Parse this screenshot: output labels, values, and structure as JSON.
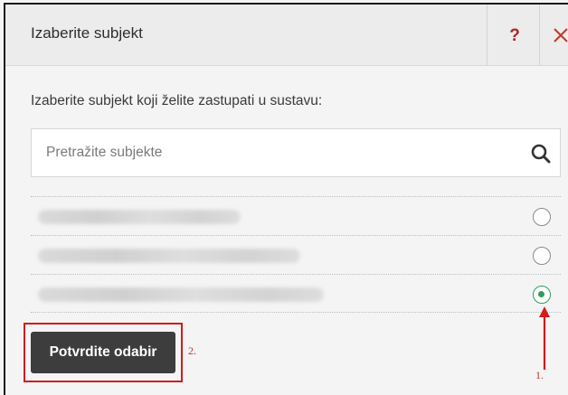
{
  "dialog": {
    "title": "Izaberite subjekt",
    "help_label": "?",
    "instruction": "Izaberite subjekt koji želite zastupati u sustavu:",
    "search": {
      "placeholder": "Pretražite subjekte",
      "value": ""
    },
    "subjects": [
      {
        "name_blurred": true,
        "selected": false
      },
      {
        "name_blurred": true,
        "selected": false
      },
      {
        "name_blurred": true,
        "selected": true
      }
    ],
    "confirm_label": "Potvrdite odabir"
  },
  "annotations": {
    "step1": "1.",
    "step2": "2."
  },
  "icons": {
    "help": "question-mark-icon",
    "close": "close-icon",
    "search": "search-icon"
  },
  "colors": {
    "accent_red": "#d01c1c",
    "radio_selected": "#2e9e5b",
    "button_bg": "#3d3d3d"
  }
}
